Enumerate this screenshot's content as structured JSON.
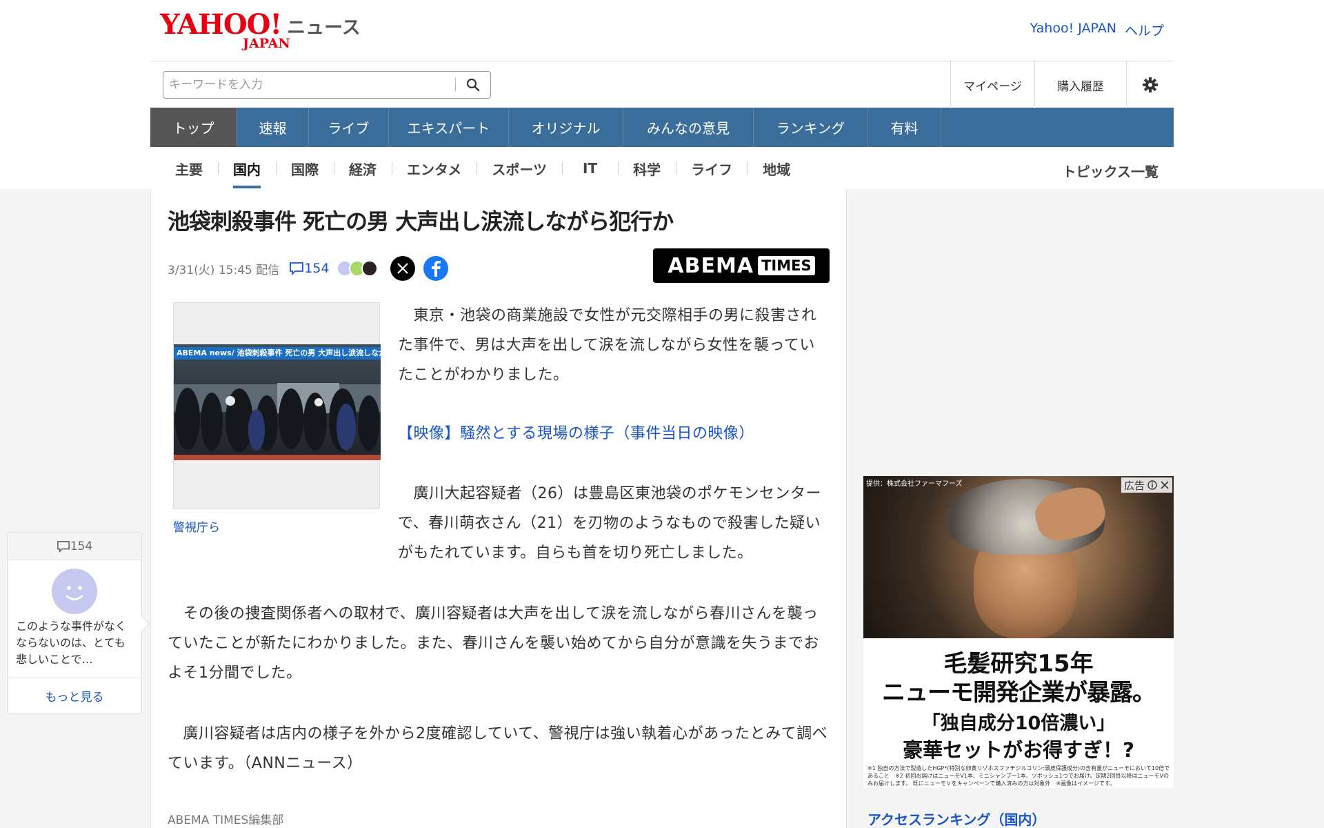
{
  "header": {
    "logo_text": "YAHOO!",
    "logo_sub": "JAPAN",
    "service": "ニュース",
    "links": [
      "Yahoo! JAPAN",
      "ヘルプ"
    ]
  },
  "search": {
    "placeholder": "キーワードを入力",
    "value": ""
  },
  "util_links": [
    "マイページ",
    "購入履歴"
  ],
  "nav": {
    "items": [
      "トップ",
      "速報",
      "ライブ",
      "エキスパート",
      "オリジナル",
      "みんなの意見",
      "ランキング",
      "有料"
    ],
    "active": "トップ"
  },
  "subnav": {
    "items": [
      "主要",
      "国内",
      "国際",
      "経済",
      "エンタメ",
      "スポーツ",
      "IT",
      "科学",
      "ライフ",
      "地域"
    ],
    "active": "国内",
    "topics_link": "トピックス一覧"
  },
  "article": {
    "headline": "池袋刺殺事件 死亡の男 大声出し涙流しながら犯行か",
    "date": "3/31(火) 15:45 配信",
    "comment_count": "154",
    "publisher_logo": {
      "main": "ABEMA",
      "badge": "TIMES"
    },
    "photo_band_text": "ABEMA news/ 池袋刺殺事件 死亡の男 大声出し涙流しながら犯行か",
    "photo_caption": "警視庁ら",
    "paragraph1": "　東京・池袋の商業施設で女性が元交際相手の男に殺害された事件で、男は大声を出して涙を流しながら女性を襲っていたことがわかりました。",
    "video_link": "【映像】騒然とする現場の様子（事件当日の映像）",
    "paragraph2": "　廣川大起容疑者（26）は豊島区東池袋のポケモンセンターで、春川萌衣さん（21）を刃物のようなもので殺害した疑いがもたれています。自らも首を切り死亡しました。",
    "paragraph3": "　その後の捜査関係者への取材で、廣川容疑者は大声を出して涙を流しながら春川さんを襲っていたことが新たにわかりました。また、春川さんを襲い始めてから自分が意識を失うまでおよそ1分間でした。",
    "paragraph4": "　廣川容疑者は店内の様子を外から2度確認していて、警視庁は強い執着心があったとみて調べています。（ANNニュース）",
    "byline": "ABEMA TIMES編集部"
  },
  "comment_widget": {
    "count": "154",
    "preview": "このような事件がなくならないのは、とても悲しいことで…",
    "more": "もっと見る"
  },
  "ad": {
    "provider": "提供：株式会社ファーマフーズ",
    "label": "広告",
    "line1": "毛髪研究15年",
    "line2": "ニューモ開発企業が暴露。",
    "line3": "「独自成分10倍濃い」",
    "line4": "豪華セットがお得すぎ！?",
    "note": "※1 独自の方法で製造したHGP*(特別な卵黄リゾホスファチジルコリン:頭皮保護成分)の含有量がニューモにおいて10倍であること　※2 初回お届けはニューモV1本、ミニシャンプー1本、ツボッシュ1つでお届け。定期2回目以降はニューモVのみお届けします。 既にニューモＶをキャンペーンで購入済みの方は対象外　※画像はイメージです。"
  },
  "ranking_title": "アクセスランキング（国内）",
  "colors": {
    "brand_red": "#e60012",
    "nav_blue": "#3a6d9a",
    "link_blue": "#1a55c7"
  }
}
